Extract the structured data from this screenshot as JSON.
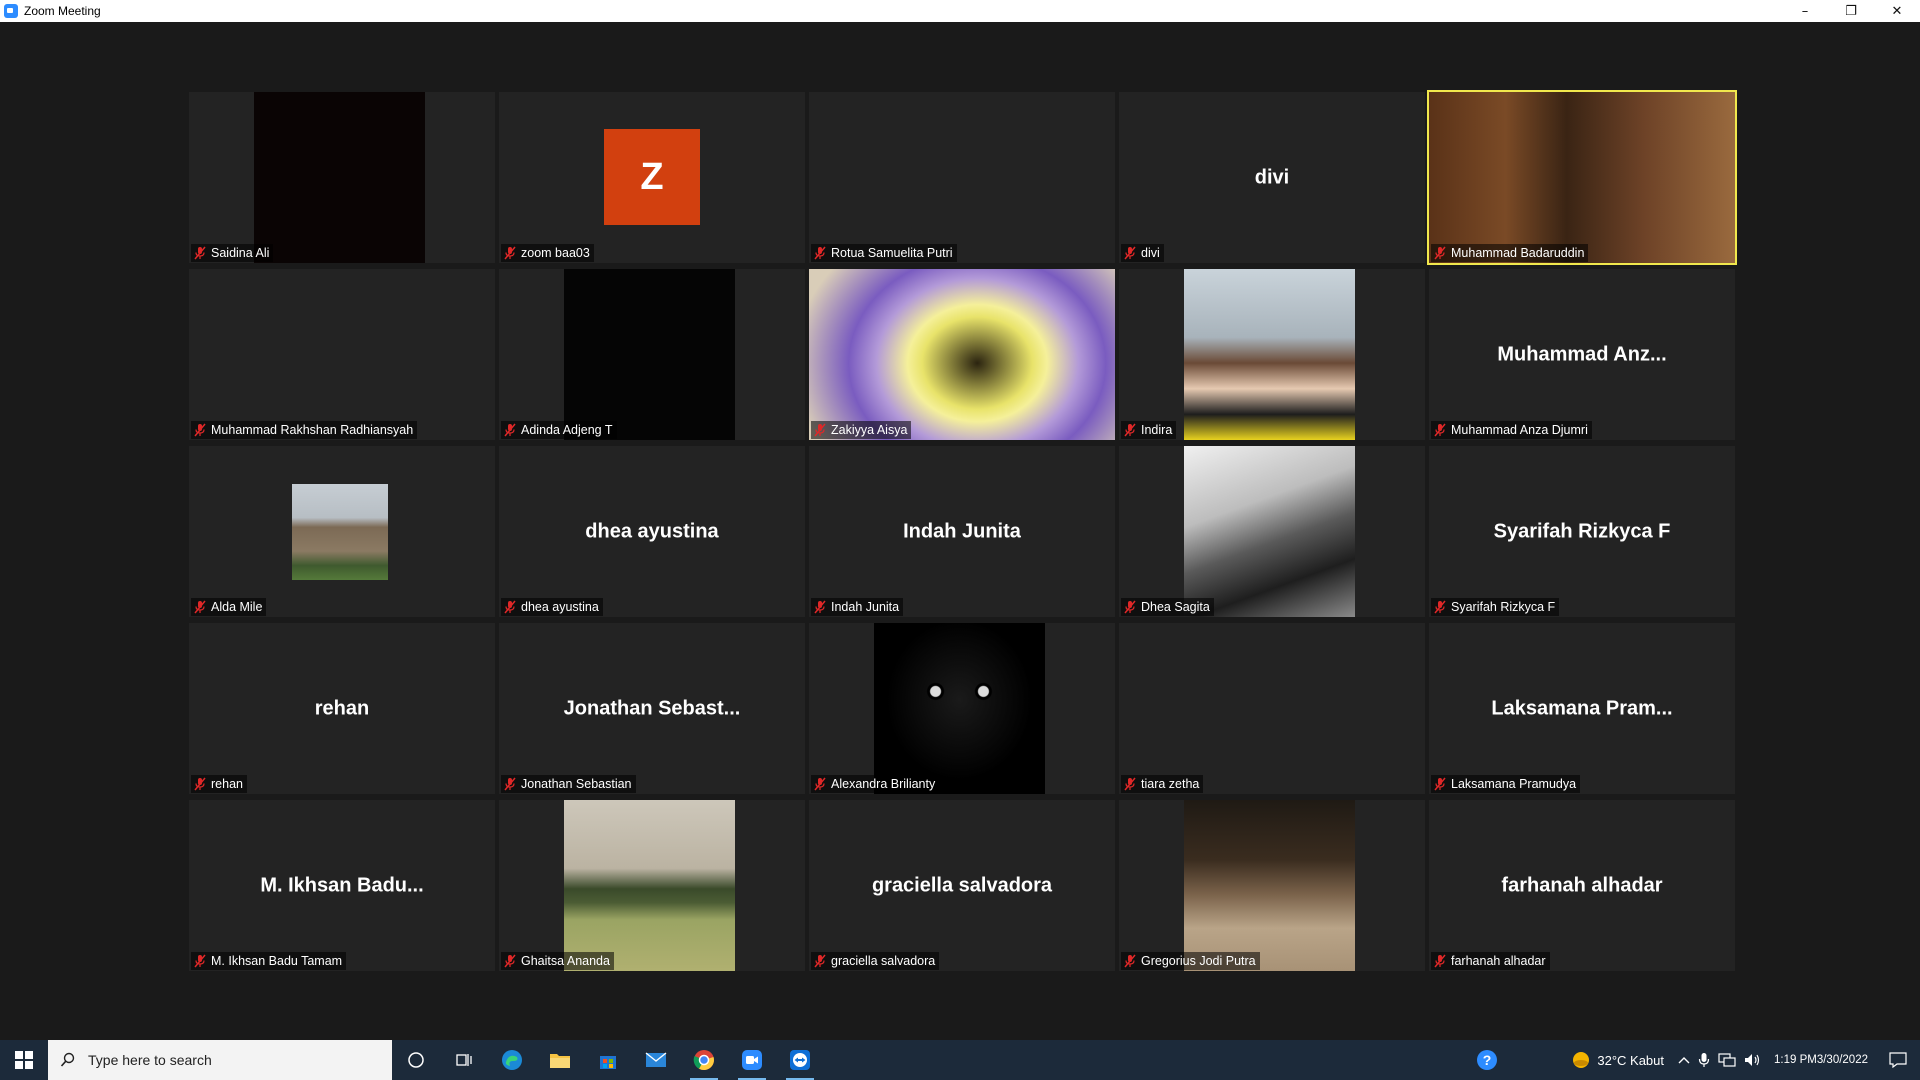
{
  "window": {
    "title": "Zoom Meeting",
    "controls": {
      "minimize": "–",
      "restore": "❐",
      "close": "✕"
    }
  },
  "participants": [
    {
      "name": "Saidina Ali",
      "display": "",
      "kind": "video",
      "video": "dark"
    },
    {
      "name": "zoom baa03",
      "display": "",
      "kind": "avatar",
      "initial": "Z"
    },
    {
      "name": "Rotua Samuelita Putri",
      "display": "",
      "kind": "blank"
    },
    {
      "name": "divi",
      "display": "divi",
      "kind": "name"
    },
    {
      "name": "Muhammad Badaruddin",
      "display": "",
      "kind": "video",
      "video": "library",
      "active": true
    },
    {
      "name": "Muhammad Rakhshan Radhiansyah",
      "display": "",
      "kind": "blank"
    },
    {
      "name": "Adinda Adjeng T",
      "display": "",
      "kind": "video",
      "video": "black"
    },
    {
      "name": "Zakiyya Aisya",
      "display": "",
      "kind": "video",
      "video": "lamp"
    },
    {
      "name": "Indira",
      "display": "",
      "kind": "video",
      "video": "portrait"
    },
    {
      "name": "Muhammad Anza Djumri",
      "display": "Muhammad  Anz...",
      "kind": "name"
    },
    {
      "name": "Alda Mile",
      "display": "",
      "kind": "video",
      "video": "castle"
    },
    {
      "name": "dhea ayustina",
      "display": "dhea ayustina",
      "kind": "name"
    },
    {
      "name": "Indah Junita",
      "display": "Indah Junita",
      "kind": "name"
    },
    {
      "name": "Dhea Sagita",
      "display": "",
      "kind": "video",
      "video": "singer"
    },
    {
      "name": "Syarifah Rizkyca F",
      "display": "Syarifah Rizkyca F",
      "kind": "name"
    },
    {
      "name": "rehan",
      "display": "rehan",
      "kind": "name"
    },
    {
      "name": "Jonathan Sebastian",
      "display": "Jonathan  Sebast...",
      "kind": "name"
    },
    {
      "name": "Alexandra Brilianty",
      "display": "",
      "kind": "video",
      "video": "cat"
    },
    {
      "name": "tiara zetha",
      "display": "",
      "kind": "blank"
    },
    {
      "name": "Laksamana Pramudya",
      "display": "Laksamana  Pram...",
      "kind": "name"
    },
    {
      "name": "M. Ikhsan Badu Tamam",
      "display": "M.  Ikhsan  Badu...",
      "kind": "name"
    },
    {
      "name": "Ghaitsa Ananda",
      "display": "",
      "kind": "video",
      "video": "field"
    },
    {
      "name": "graciella salvadora",
      "display": "graciella salvadora",
      "kind": "name"
    },
    {
      "name": "Gregorius Jodi Putra",
      "display": "",
      "kind": "video",
      "video": "hall"
    },
    {
      "name": "farhanah alhadar",
      "display": "farhanah alhadar",
      "kind": "name"
    }
  ],
  "taskbar": {
    "search_placeholder": "Type here to search",
    "weather": "32°C  Kabut",
    "time": "1:19 PM",
    "date": "3/30/2022"
  },
  "colors": {
    "active_speaker": "#f1e84d",
    "muted_icon": "#e02828",
    "zoom_avatar": "#d2400f"
  }
}
